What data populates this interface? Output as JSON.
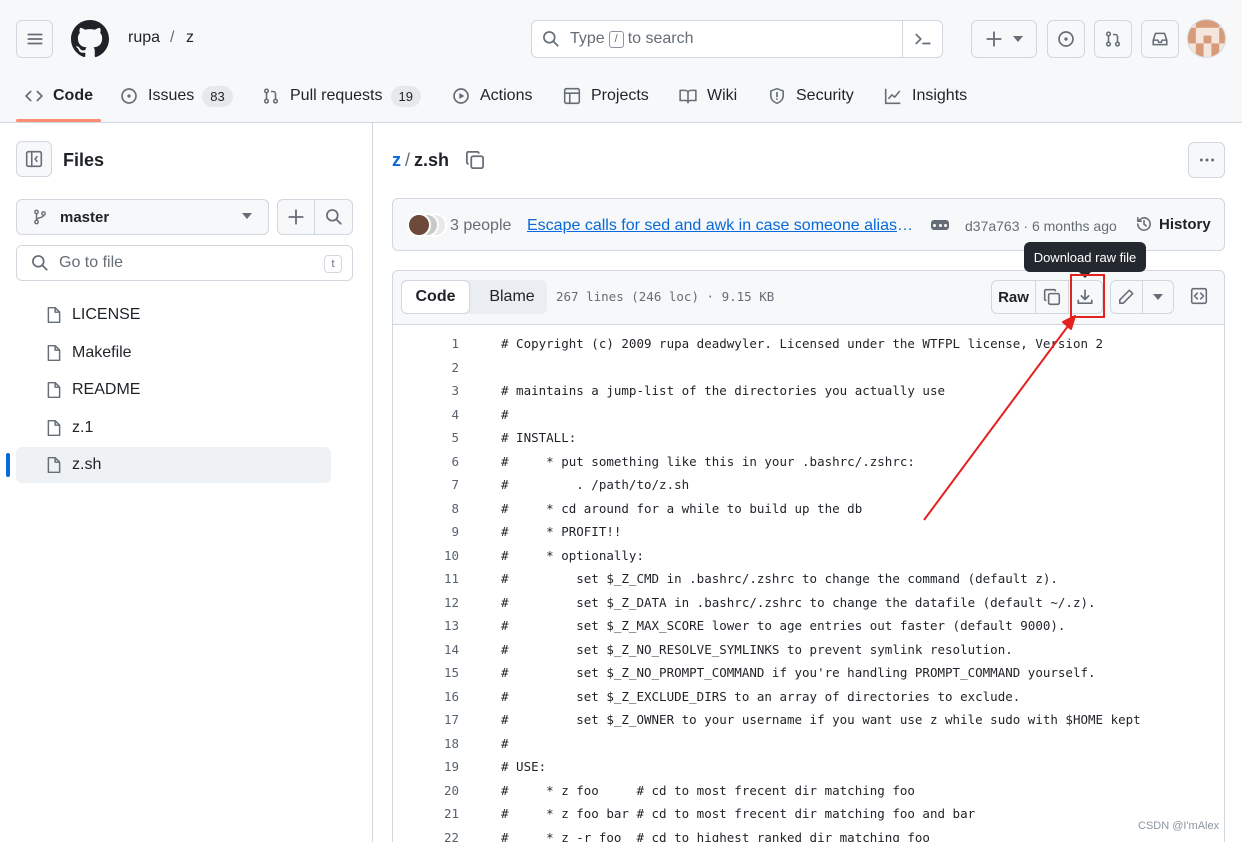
{
  "header": {
    "owner": "rupa",
    "separator": "/",
    "repo": "z",
    "search": {
      "prefix": "Type",
      "key": "/",
      "suffix": "to search"
    }
  },
  "repo_nav": [
    {
      "label": "Code",
      "icon": "code-icon"
    },
    {
      "label": "Issues",
      "icon": "issue-icon",
      "count": "83"
    },
    {
      "label": "Pull requests",
      "icon": "pull-request-icon",
      "count": "19"
    },
    {
      "label": "Actions",
      "icon": "play-icon"
    },
    {
      "label": "Projects",
      "icon": "table-icon"
    },
    {
      "label": "Wiki",
      "icon": "book-icon"
    },
    {
      "label": "Security",
      "icon": "shield-icon"
    },
    {
      "label": "Insights",
      "icon": "graph-icon"
    }
  ],
  "sidebar": {
    "title": "Files",
    "branch": "master",
    "goto_placeholder": "Go to file",
    "goto_key": "t",
    "files": [
      "LICENSE",
      "Makefile",
      "README",
      "z.1",
      "z.sh"
    ],
    "active_file": "z.sh"
  },
  "file": {
    "repo": "z",
    "separator": "/",
    "name": "z.sh",
    "commit": {
      "people": "3 people",
      "message": "Escape calls for sed and awk in case someone aliases them",
      "sha_age": "d37a763 · 6 months ago",
      "history": "History"
    },
    "tabs": {
      "code": "Code",
      "blame": "Blame"
    },
    "info": "267 lines (246 loc) · 9.15 KB",
    "raw_label": "Raw",
    "tooltip": "Download raw file"
  },
  "code_lines": [
    "# Copyright (c) 2009 rupa deadwyler. Licensed under the WTFPL license, Version 2",
    "",
    "# maintains a jump-list of the directories you actually use",
    "#",
    "# INSTALL:",
    "#     * put something like this in your .bashrc/.zshrc:",
    "#         . /path/to/z.sh",
    "#     * cd around for a while to build up the db",
    "#     * PROFIT!!",
    "#     * optionally:",
    "#         set $_Z_CMD in .bashrc/.zshrc to change the command (default z).",
    "#         set $_Z_DATA in .bashrc/.zshrc to change the datafile (default ~/.z).",
    "#         set $_Z_MAX_SCORE lower to age entries out faster (default 9000).",
    "#         set $_Z_NO_RESOLVE_SYMLINKS to prevent symlink resolution.",
    "#         set $_Z_NO_PROMPT_COMMAND if you're handling PROMPT_COMMAND yourself.",
    "#         set $_Z_EXCLUDE_DIRS to an array of directories to exclude.",
    "#         set $_Z_OWNER to your username if you want use z while sudo with $HOME kept",
    "#",
    "# USE:",
    "#     * z foo     # cd to most frecent dir matching foo",
    "#     * z foo bar # cd to most frecent dir matching foo and bar",
    "#     * z -r foo  # cd to highest ranked dir matching foo"
  ],
  "watermark": "CSDN @I'mAlex",
  "colors": {
    "accent": "#0969da",
    "tab_underline": "#fd8c73",
    "annotation": "#e3211e"
  }
}
